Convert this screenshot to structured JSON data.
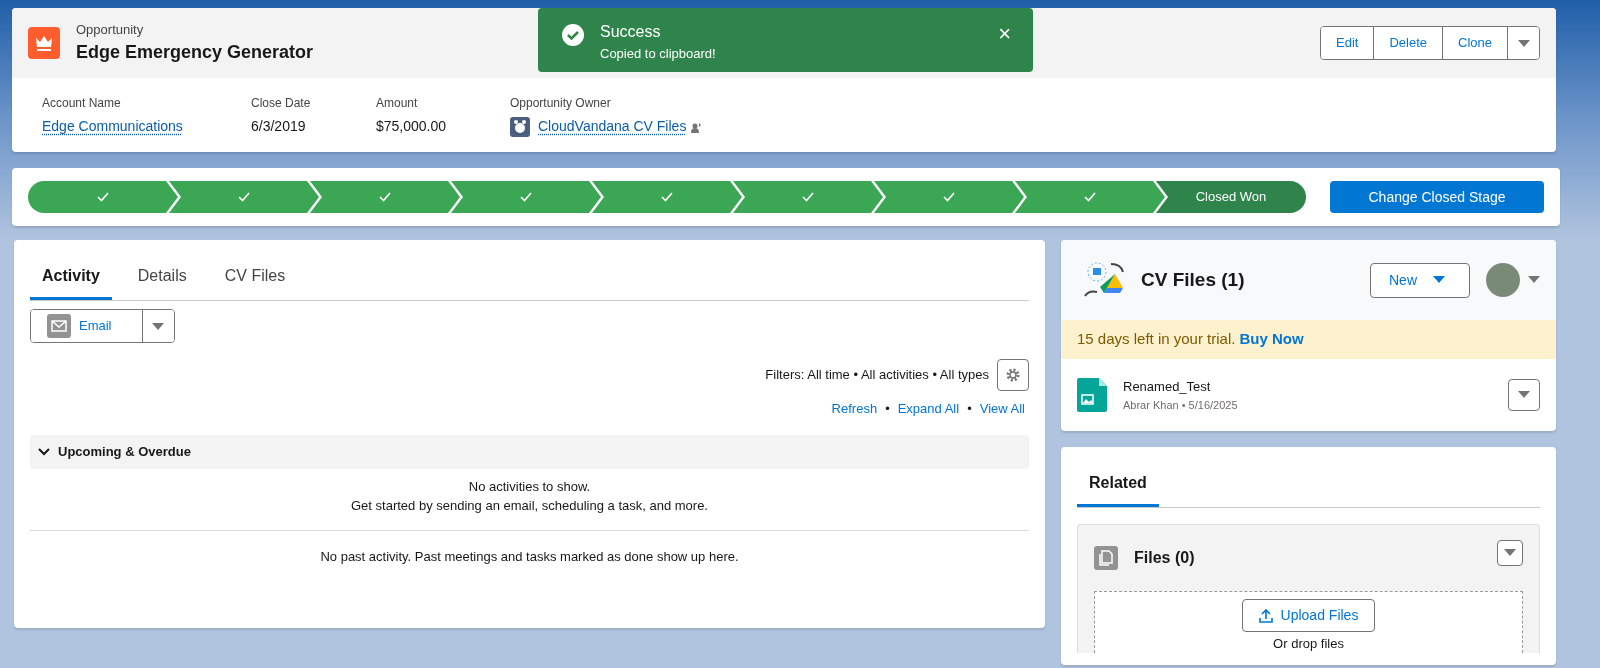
{
  "header": {
    "object_type": "Opportunity",
    "title": "Edge Emergency Generator",
    "actions": [
      "Edit",
      "Delete",
      "Clone"
    ],
    "fields": [
      {
        "label": "Account Name",
        "value": "Edge Communications",
        "kind": "link"
      },
      {
        "label": "Close Date",
        "value": "6/3/2019",
        "kind": "text"
      },
      {
        "label": "Amount",
        "value": "$75,000.00",
        "kind": "text"
      },
      {
        "label": "Opportunity Owner",
        "value": "CloudVandana CV Files",
        "kind": "owner"
      }
    ]
  },
  "toast": {
    "title": "Success",
    "message": "Copied to clipboard!",
    "close": "×"
  },
  "path": {
    "stages": [
      {
        "kind": "complete"
      },
      {
        "kind": "complete"
      },
      {
        "kind": "complete"
      },
      {
        "kind": "complete"
      },
      {
        "kind": "complete"
      },
      {
        "kind": "complete"
      },
      {
        "kind": "complete"
      },
      {
        "kind": "complete"
      },
      {
        "kind": "current",
        "label": "Closed Won"
      }
    ],
    "button": "Change Closed Stage"
  },
  "activity": {
    "tabs": [
      {
        "label": "Activity",
        "selected": true
      },
      {
        "label": "Details",
        "selected": false
      },
      {
        "label": "CV Files",
        "selected": false
      }
    ],
    "email_button": "Email",
    "filters": "Filters: All time • All activities • All types",
    "links": [
      "Refresh",
      "Expand All",
      "View All"
    ],
    "separator": "•",
    "section": {
      "title": "Upcoming & Overdue",
      "expanded": true,
      "empty_lines": [
        "No activities to show.",
        "Get started by sending an email, scheduling a task, and more."
      ]
    },
    "past": "No past activity. Past meetings and tasks marked as done show up here."
  },
  "cv_files": {
    "title": "CV Files (1)",
    "new_button": "New",
    "trial": "15 days left in your trial.",
    "buy": "Buy Now",
    "files": [
      {
        "name": "Renamed_Test",
        "meta": "Abrar Khan • 5/16/2025"
      }
    ]
  },
  "related": {
    "tabs": [
      {
        "label": "Related",
        "selected": true
      }
    ],
    "files_title": "Files (0)",
    "upload": "Upload Files",
    "drop": "Or drop files"
  }
}
